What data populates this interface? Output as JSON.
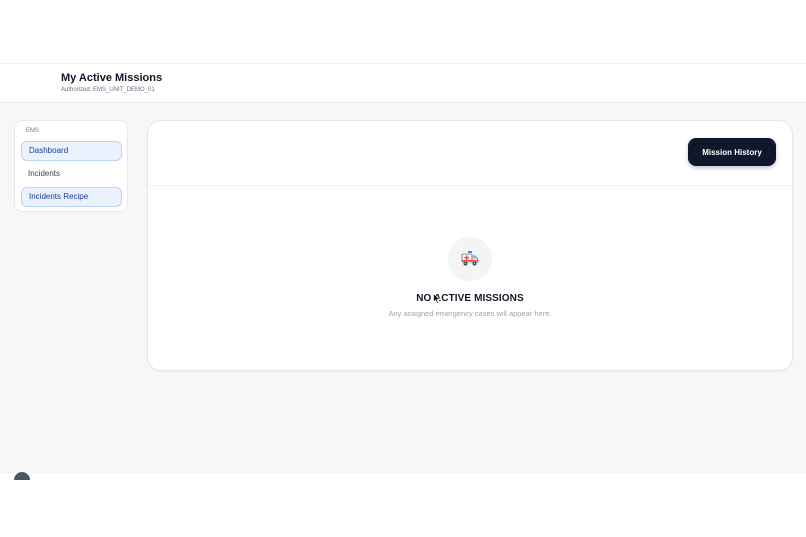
{
  "header": {
    "title": "My Active Missions",
    "subtitle": "Authorized: EMS_UNIT_DEMO_01"
  },
  "sidebar": {
    "heading": "EMS",
    "items": [
      {
        "label": "Dashboard",
        "active": true
      },
      {
        "label": "Incidents",
        "active": false
      },
      {
        "label": "Incidents Recipe",
        "active": true
      }
    ]
  },
  "main": {
    "history_button_label": "Mission History",
    "empty_state": {
      "icon": "ambulance-icon",
      "title": "NO ACTIVE MISSIONS",
      "description": "Any assigned emergency cases will appear here."
    }
  },
  "colors": {
    "primary_button": "#0f172a",
    "active_nav_bg": "#eaf2fe",
    "active_nav_border": "#bcd4f4",
    "app_background": "#f6f8f8"
  }
}
